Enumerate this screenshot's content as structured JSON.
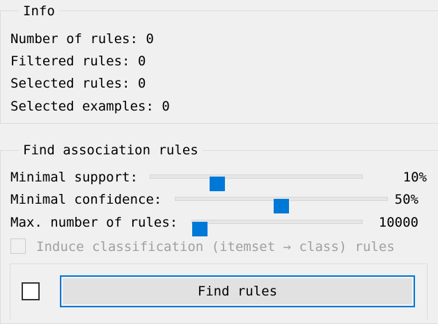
{
  "info": {
    "title": "Info",
    "number_of_rules": "Number of rules: 0",
    "filtered_rules": "Filtered rules: 0",
    "selected_rules": "Selected rules: 0",
    "selected_examples": "Selected examples: 0"
  },
  "find": {
    "title": "Find association rules",
    "min_support": {
      "label": "Minimal support:",
      "value_text": "10%",
      "level": 0.3
    },
    "min_confidence": {
      "label": "Minimal confidence:",
      "value_text": "50%",
      "level": 0.5
    },
    "max_rules": {
      "label": "Max. number of rules:",
      "value_text": "10000",
      "level": 0.0
    },
    "induce_classification": {
      "label": "Induce classification (itemset → class) rules",
      "checked": false,
      "enabled": false
    }
  },
  "actions": {
    "auto_find_checked": false,
    "find_rules_label": "Find rules"
  },
  "colors": {
    "accent": "#0078d7",
    "background": "#f0f0f0",
    "disabled_text": "#a0a0a0"
  }
}
